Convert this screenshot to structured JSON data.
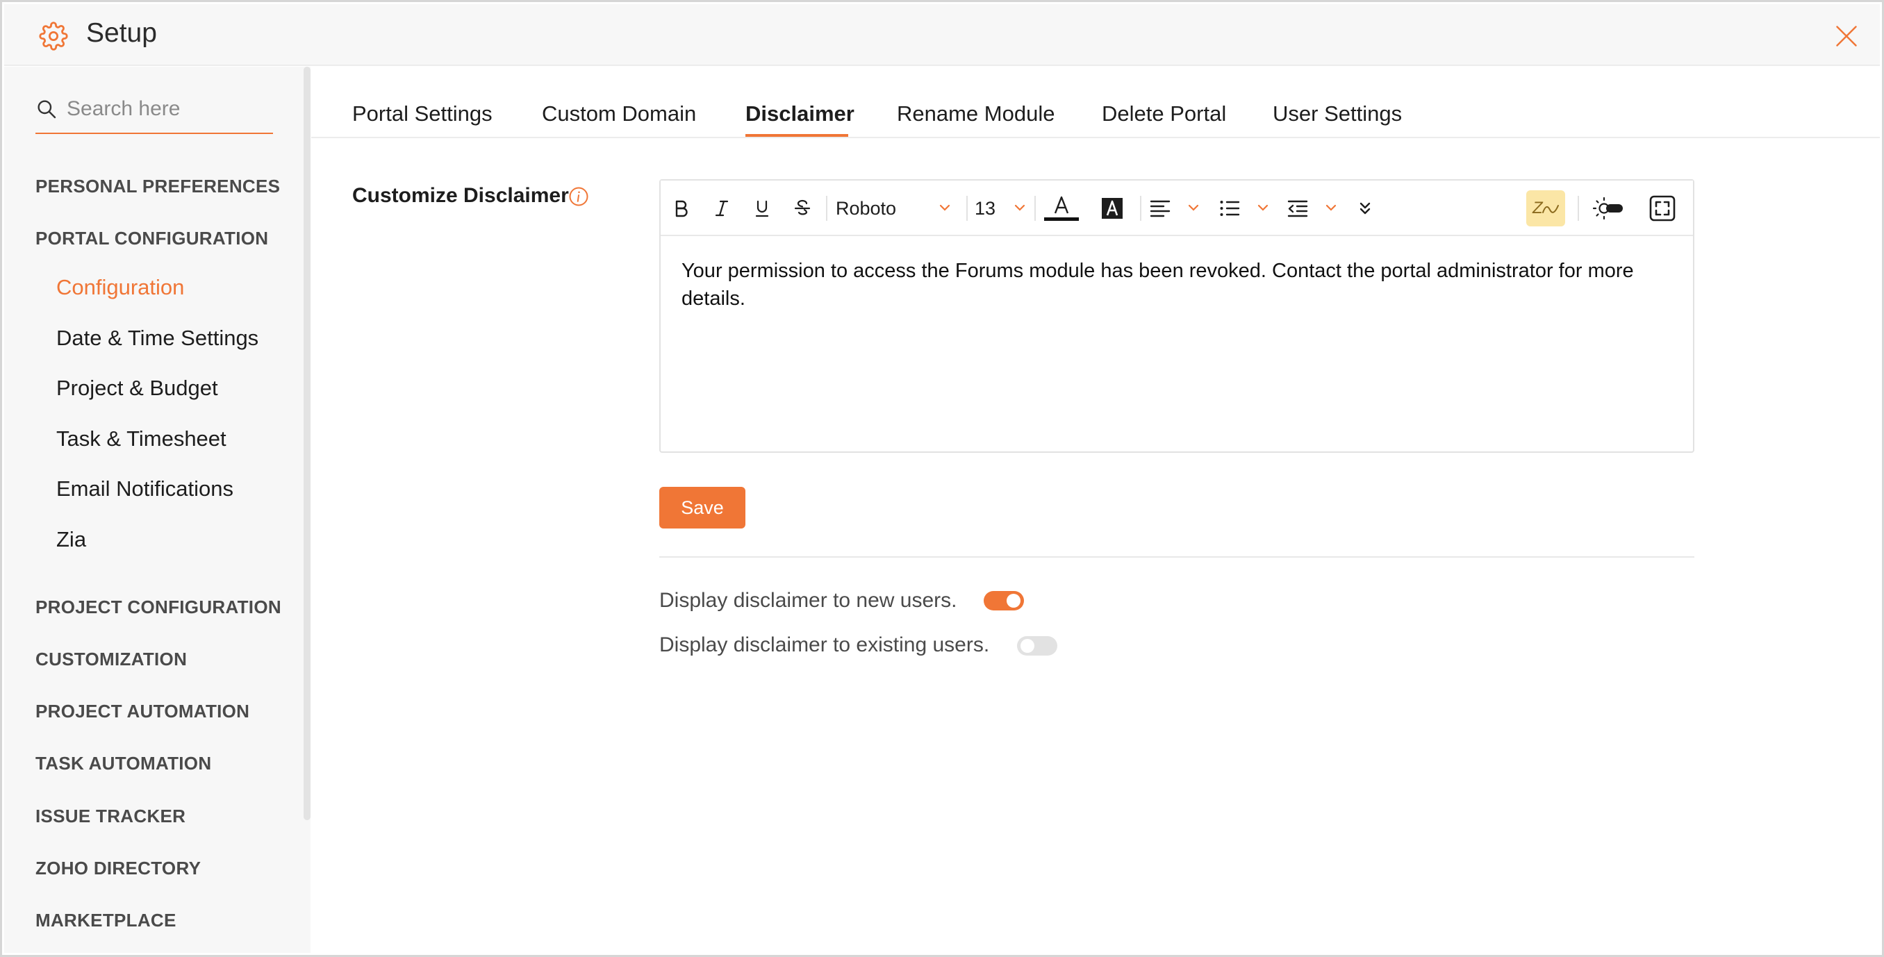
{
  "header": {
    "title": "Setup",
    "gear_icon": "gear-icon",
    "close_icon": "close-icon",
    "accent": "#f07636"
  },
  "sidebar": {
    "search_placeholder": "Search here",
    "sections": [
      "PERSONAL PREFERENCES",
      "PORTAL CONFIGURATION",
      "PROJECT CONFIGURATION",
      "CUSTOMIZATION",
      "PROJECT AUTOMATION",
      "TASK AUTOMATION",
      "ISSUE TRACKER",
      "ZOHO DIRECTORY",
      "MARKETPLACE"
    ],
    "portal_items": [
      "Configuration",
      "Date & Time Settings",
      "Project & Budget",
      "Task & Timesheet",
      "Email Notifications",
      "Zia"
    ],
    "active_item": "Configuration"
  },
  "tabs": [
    "Portal Settings",
    "Custom Domain",
    "Disclaimer",
    "Rename Module",
    "Delete Portal",
    "User Settings"
  ],
  "active_tab": "Disclaimer",
  "disclaimer": {
    "label": "Customize Disclaimer",
    "toolbar": {
      "font": "Roboto",
      "size": "13",
      "zia": "Zia"
    },
    "text": "Your permission to access the Forums module has been revoked. Contact the portal administrator for more details.",
    "save_label": "Save",
    "options": [
      {
        "label": "Display disclaimer to new users.",
        "enabled": true
      },
      {
        "label": "Display disclaimer to existing users.",
        "enabled": false
      }
    ]
  }
}
